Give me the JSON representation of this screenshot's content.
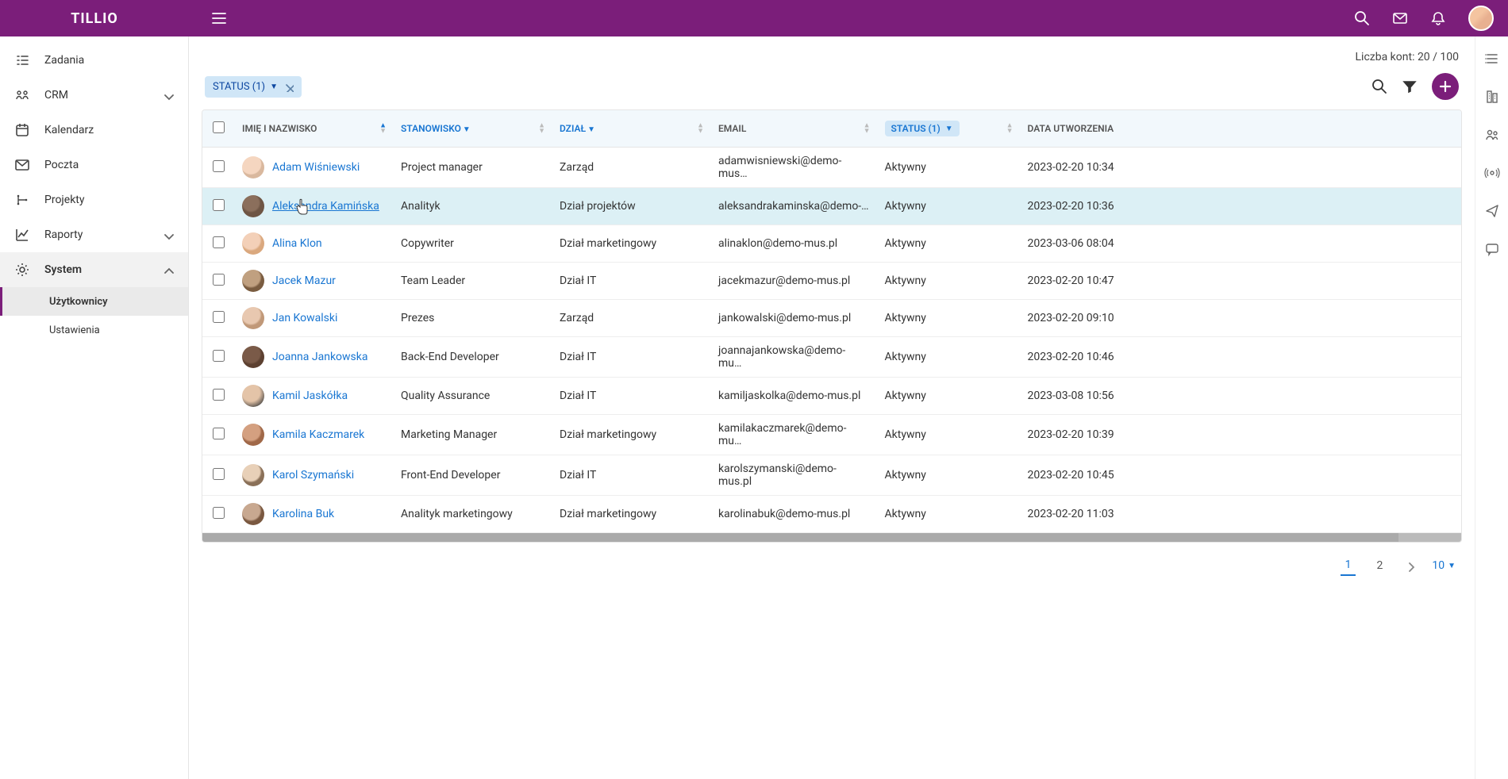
{
  "brand": "TILLIO",
  "topbar": {},
  "sidebar": {
    "items": [
      {
        "label": "Zadania"
      },
      {
        "label": "CRM",
        "expandable": true
      },
      {
        "label": "Kalendarz"
      },
      {
        "label": "Poczta"
      },
      {
        "label": "Projekty"
      },
      {
        "label": "Raporty",
        "expandable": true
      },
      {
        "label": "System",
        "expandable": true,
        "expanded": true
      }
    ],
    "system_sub": [
      {
        "label": "Użytkownicy",
        "active": true
      },
      {
        "label": "Ustawienia"
      }
    ]
  },
  "accounts_count_text": "Liczba kont: 20 / 100",
  "filter_chip": "STATUS (1)",
  "columns": {
    "name": "IMIĘ I NAZWISKO",
    "position": "STANOWISKO",
    "dept": "DZIAŁ",
    "email": "EMAIL",
    "status": "STATUS (1)",
    "created": "DATA UTWORZENIA"
  },
  "rows": [
    {
      "name": "Adam Wiśniewski",
      "position": "Project manager",
      "dept": "Zarząd",
      "email": "adamwisniewski@demo-mus…",
      "status": "Aktywny",
      "created": "2023-02-20 10:34",
      "avatar_class": "av-1"
    },
    {
      "name": "Aleksandra Kamińska",
      "position": "Analityk",
      "dept": "Dział projektów",
      "email": "aleksandrakaminska@demo-…",
      "status": "Aktywny",
      "created": "2023-02-20 10:36",
      "avatar_class": "av-2",
      "hovered": true
    },
    {
      "name": "Alina Klon",
      "position": "Copywriter",
      "dept": "Dział marketingowy",
      "email": "alinaklon@demo-mus.pl",
      "status": "Aktywny",
      "created": "2023-03-06 08:04",
      "avatar_class": "av-3"
    },
    {
      "name": "Jacek Mazur",
      "position": "Team Leader",
      "dept": "Dział IT",
      "email": "jacekmazur@demo-mus.pl",
      "status": "Aktywny",
      "created": "2023-02-20 10:47",
      "avatar_class": "av-4"
    },
    {
      "name": "Jan Kowalski",
      "position": "Prezes",
      "dept": "Zarząd",
      "email": "jankowalski@demo-mus.pl",
      "status": "Aktywny",
      "created": "2023-02-20 09:10",
      "avatar_class": "av-5"
    },
    {
      "name": "Joanna Jankowska",
      "position": "Back-End Developer",
      "dept": "Dział IT",
      "email": "joannajankowska@demo-mu…",
      "status": "Aktywny",
      "created": "2023-02-20 10:46",
      "avatar_class": "av-6"
    },
    {
      "name": "Kamil Jaskółka",
      "position": "Quality Assurance",
      "dept": "Dział IT",
      "email": "kamiljaskolka@demo-mus.pl",
      "status": "Aktywny",
      "created": "2023-03-08 10:56",
      "avatar_class": "av-7"
    },
    {
      "name": "Kamila Kaczmarek",
      "position": "Marketing Manager",
      "dept": "Dział marketingowy",
      "email": "kamilakaczmarek@demo-mu…",
      "status": "Aktywny",
      "created": "2023-02-20 10:39",
      "avatar_class": "av-8"
    },
    {
      "name": "Karol Szymański",
      "position": "Front-End Developer",
      "dept": "Dział IT",
      "email": "karolszymanski@demo-mus.pl",
      "status": "Aktywny",
      "created": "2023-02-20 10:45",
      "avatar_class": "av-9"
    },
    {
      "name": "Karolina Buk",
      "position": "Analityk marketingowy",
      "dept": "Dział marketingowy",
      "email": "karolinabuk@demo-mus.pl",
      "status": "Aktywny",
      "created": "2023-02-20 11:03",
      "avatar_class": "av-10"
    }
  ],
  "pagination": {
    "pages": [
      "1",
      "2"
    ],
    "active": "1",
    "page_size": "10"
  }
}
